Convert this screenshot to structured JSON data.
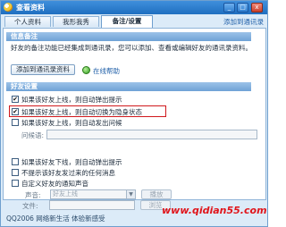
{
  "window": {
    "title": "查看资料",
    "controls": [
      "_",
      "□",
      "x"
    ]
  },
  "tabs": [
    {
      "label": "个人资料",
      "active": false
    },
    {
      "label": "我形我秀",
      "active": false
    },
    {
      "label": "备注/设置",
      "active": true
    }
  ],
  "tab_link": "添加到通讯录",
  "remarks": {
    "header": "信息备注",
    "description": "好友的备注功能已经集成到通讯录，您可以添加、查看或编辑好友的通讯录资料。",
    "add_button": "添加到通讯录资料",
    "online_help": "在线帮助"
  },
  "friend_settings": {
    "header": "好友设置",
    "options": [
      {
        "label": "如果该好友上线，则自动弹出提示",
        "checked": true
      },
      {
        "label": "如果该好友上线，则自动切换为隐身状态",
        "checked": true
      },
      {
        "label": "如果该好友上线，则自动发出问候",
        "checked": false
      }
    ],
    "greeting_label": "问候语:",
    "options2": [
      {
        "label": "如果该好友下线，则自动弹出提示",
        "checked": false
      },
      {
        "label": "不提示该好友发过来的任何消息",
        "checked": false
      },
      {
        "label": "自定义好友的通知声音",
        "checked": false
      }
    ],
    "sound_label": "声音:",
    "sound_value": "好友上线",
    "file_label": "文件:",
    "play_button": "播放",
    "browse_button": "浏览"
  },
  "footer": "QQ2006 网络新生活 体验新感受",
  "watermark": "www.qidian55.com"
}
